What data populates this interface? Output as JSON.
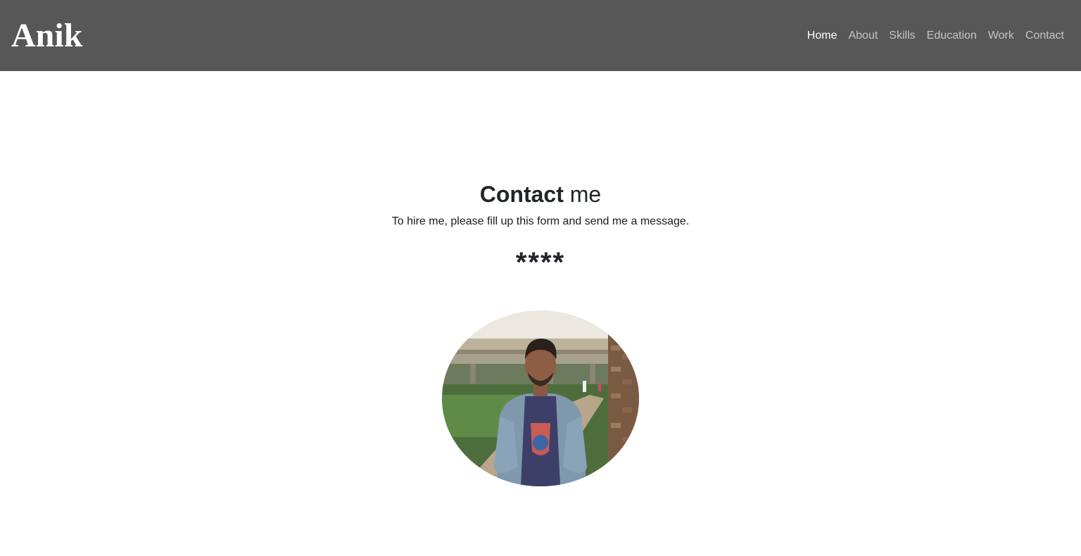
{
  "header": {
    "brand": "Anik",
    "nav": [
      {
        "label": "Home",
        "active": true
      },
      {
        "label": "About",
        "active": false
      },
      {
        "label": "Skills",
        "active": false
      },
      {
        "label": "Education",
        "active": false
      },
      {
        "label": "Work",
        "active": false
      },
      {
        "label": "Contact",
        "active": false
      }
    ]
  },
  "contact": {
    "title_bold": "Contact",
    "title_rest": " me",
    "subtitle": "To hire me, please fill up this form and send me a message.",
    "stars": "****"
  },
  "photo": {
    "icon": "profile-photo"
  },
  "colors": {
    "navbar_bg": "#575757",
    "nav_link": "#c4c4c4",
    "nav_active": "#ffffff",
    "text": "#212529"
  }
}
